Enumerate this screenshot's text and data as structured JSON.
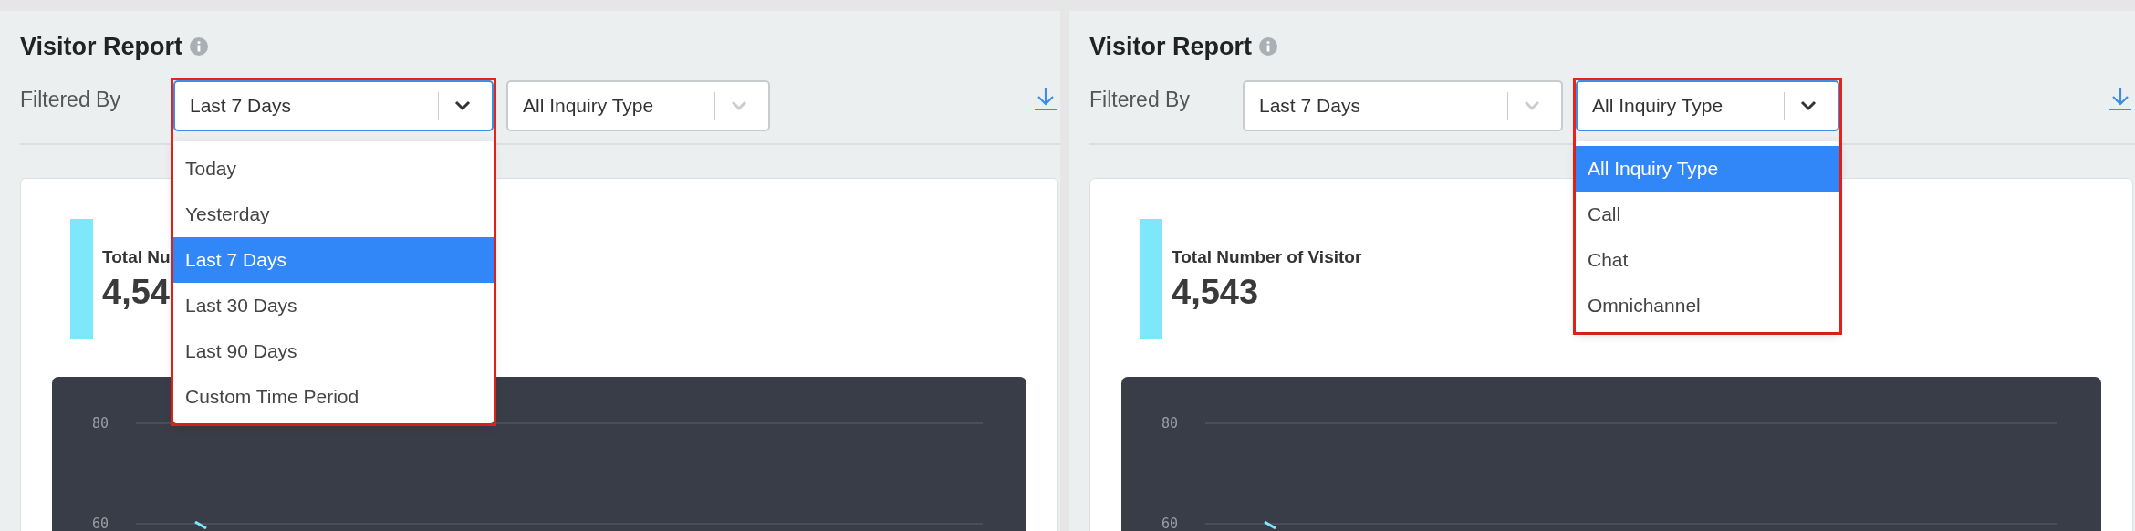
{
  "panels": [
    {
      "title": "Visitor Report",
      "filter_label": "Filtered By",
      "filters": [
        {
          "value": "Last 7 Days",
          "open": true,
          "options": [
            {
              "label": "Today",
              "selected": false
            },
            {
              "label": "Yesterday",
              "selected": false
            },
            {
              "label": "Last 7 Days",
              "selected": true
            },
            {
              "label": "Last 30 Days",
              "selected": false
            },
            {
              "label": "Last 90 Days",
              "selected": false
            },
            {
              "label": "Custom Time Period",
              "selected": false
            }
          ]
        },
        {
          "value": "All Inquiry Type",
          "open": false
        }
      ],
      "stat": {
        "label": "Total Nu",
        "value": "4,54"
      },
      "chart": {
        "y_labels": [
          "80",
          "60"
        ]
      }
    },
    {
      "title": "Visitor Report",
      "filter_label": "Filtered By",
      "filters": [
        {
          "value": "Last 7 Days",
          "open": false
        },
        {
          "value": "All Inquiry Type",
          "open": true,
          "options": [
            {
              "label": "All Inquiry Type",
              "selected": true
            },
            {
              "label": "Call",
              "selected": false
            },
            {
              "label": "Chat",
              "selected": false
            },
            {
              "label": "Omnichannel",
              "selected": false
            }
          ]
        }
      ],
      "stat": {
        "label": "Total Number of Visitor",
        "value": "4,543"
      },
      "chart": {
        "y_labels": [
          "80",
          "60"
        ]
      }
    }
  ]
}
